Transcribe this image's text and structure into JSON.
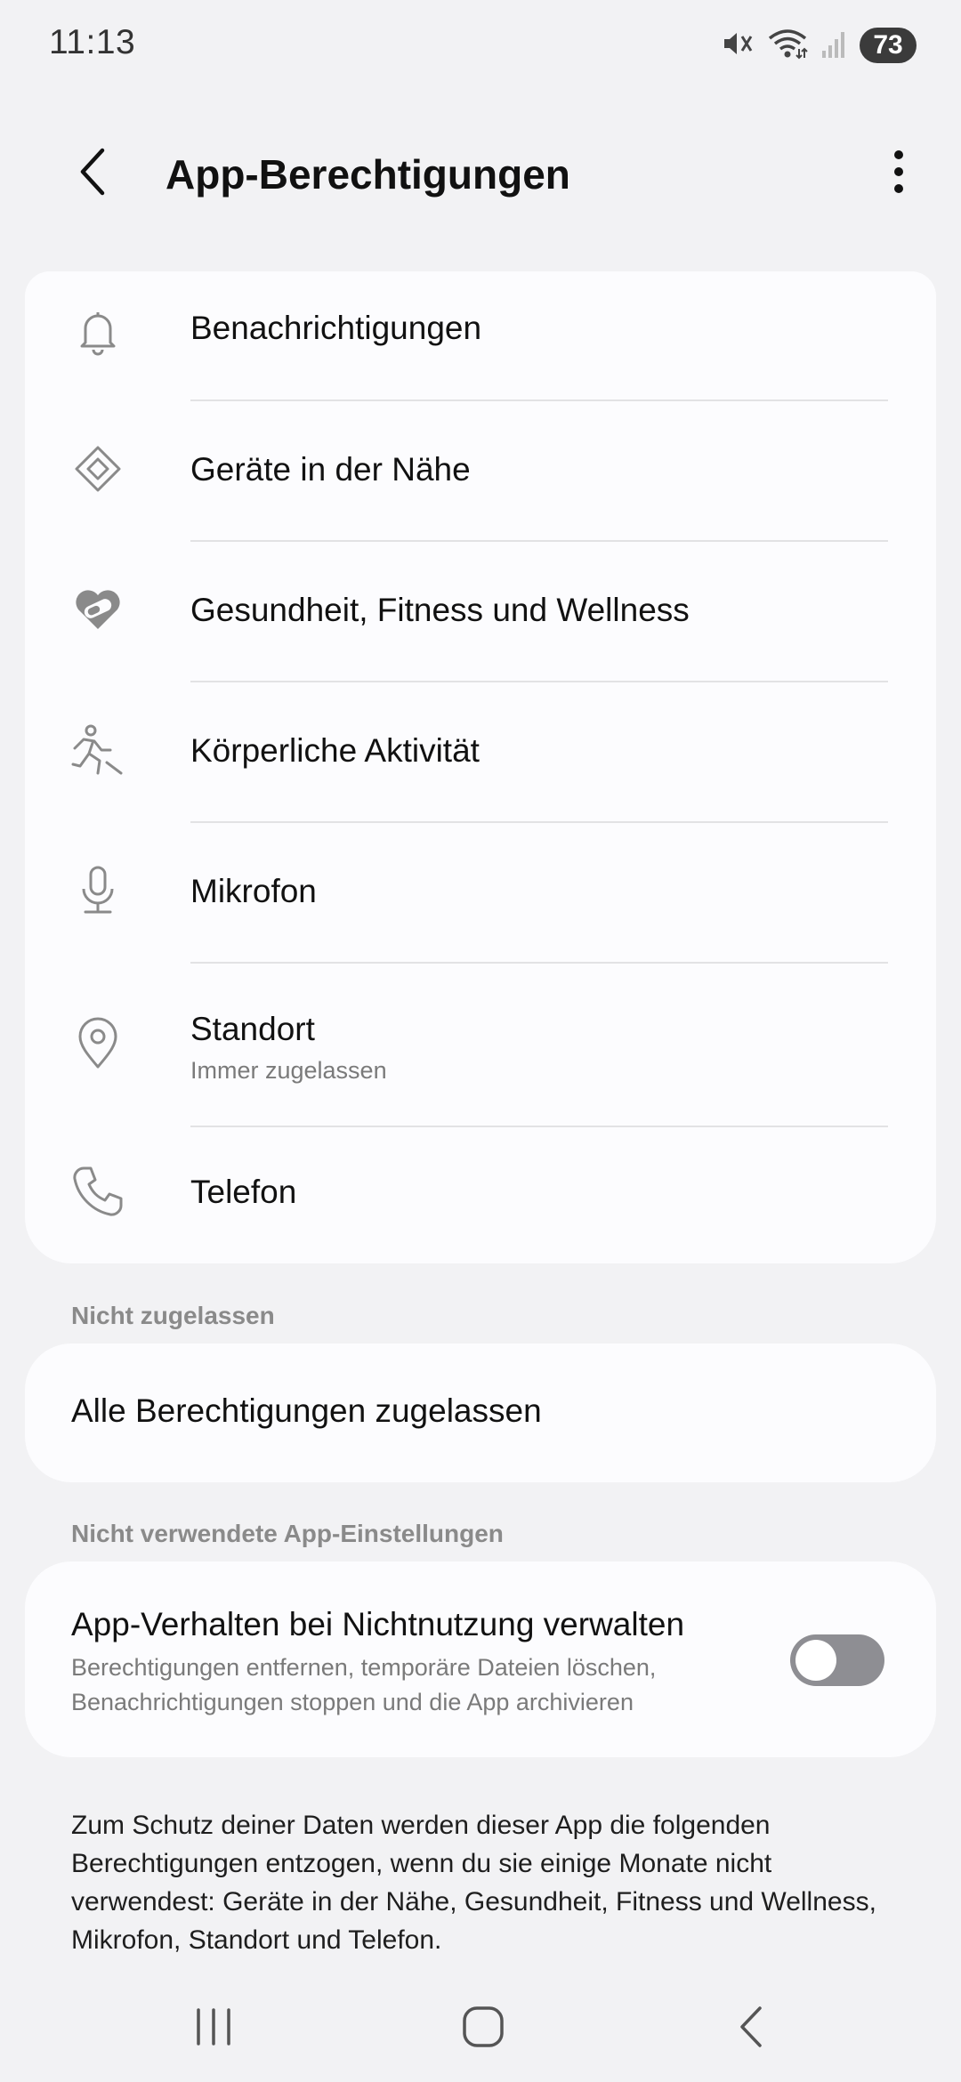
{
  "status_bar": {
    "time": "11:13",
    "battery": "73",
    "icons": [
      "mute-vibrate-icon",
      "wifi-icon",
      "signal-icon",
      "battery-icon"
    ]
  },
  "header": {
    "title": "App-Berechtigungen",
    "back_icon": "chevron-left-icon",
    "more_icon": "more-vert-icon"
  },
  "allowed_permissions": [
    {
      "label": "Benachrichtigungen",
      "icon": "bell-icon"
    },
    {
      "label": "Geräte in der Nähe",
      "icon": "nearby-devices-icon"
    },
    {
      "label": "Gesundheit, Fitness und Wellness",
      "icon": "health-heart-icon"
    },
    {
      "label": "Körperliche Aktivität",
      "icon": "running-person-icon"
    },
    {
      "label": "Mikrofon",
      "icon": "microphone-icon"
    },
    {
      "label": "Standort",
      "sublabel": "Immer zugelassen",
      "icon": "location-pin-icon"
    },
    {
      "label": "Telefon",
      "icon": "phone-icon"
    }
  ],
  "not_allowed_section": {
    "header": "Nicht zugelassen",
    "item": "Alle Berechtigungen zugelassen"
  },
  "unused_section": {
    "header": "Nicht verwendete App-Einstellungen",
    "toggle_title": "App-Verhalten bei Nichtnutzung verwalten",
    "toggle_description": "Berechtigungen entfernen, temporäre Dateien löschen, Benachrichtigungen stoppen und die App archivieren",
    "toggle_on": false
  },
  "footer_note": "Zum Schutz deiner Daten werden dieser App die folgenden Berechtigungen entzogen, wenn du sie einige Monate nicht verwendest: Geräte in der Nähe, Gesundheit, Fitness und Wellness, Mikrofon, Standort und Telefon.",
  "nav_bar": {
    "icons": [
      "recent-apps-icon",
      "home-icon",
      "back-icon"
    ]
  },
  "colors": {
    "background": "#f2f2f4",
    "card": "#fcfcfe",
    "icon_gray": "#8a8a8a",
    "toggle_off": "#8e8e93"
  }
}
